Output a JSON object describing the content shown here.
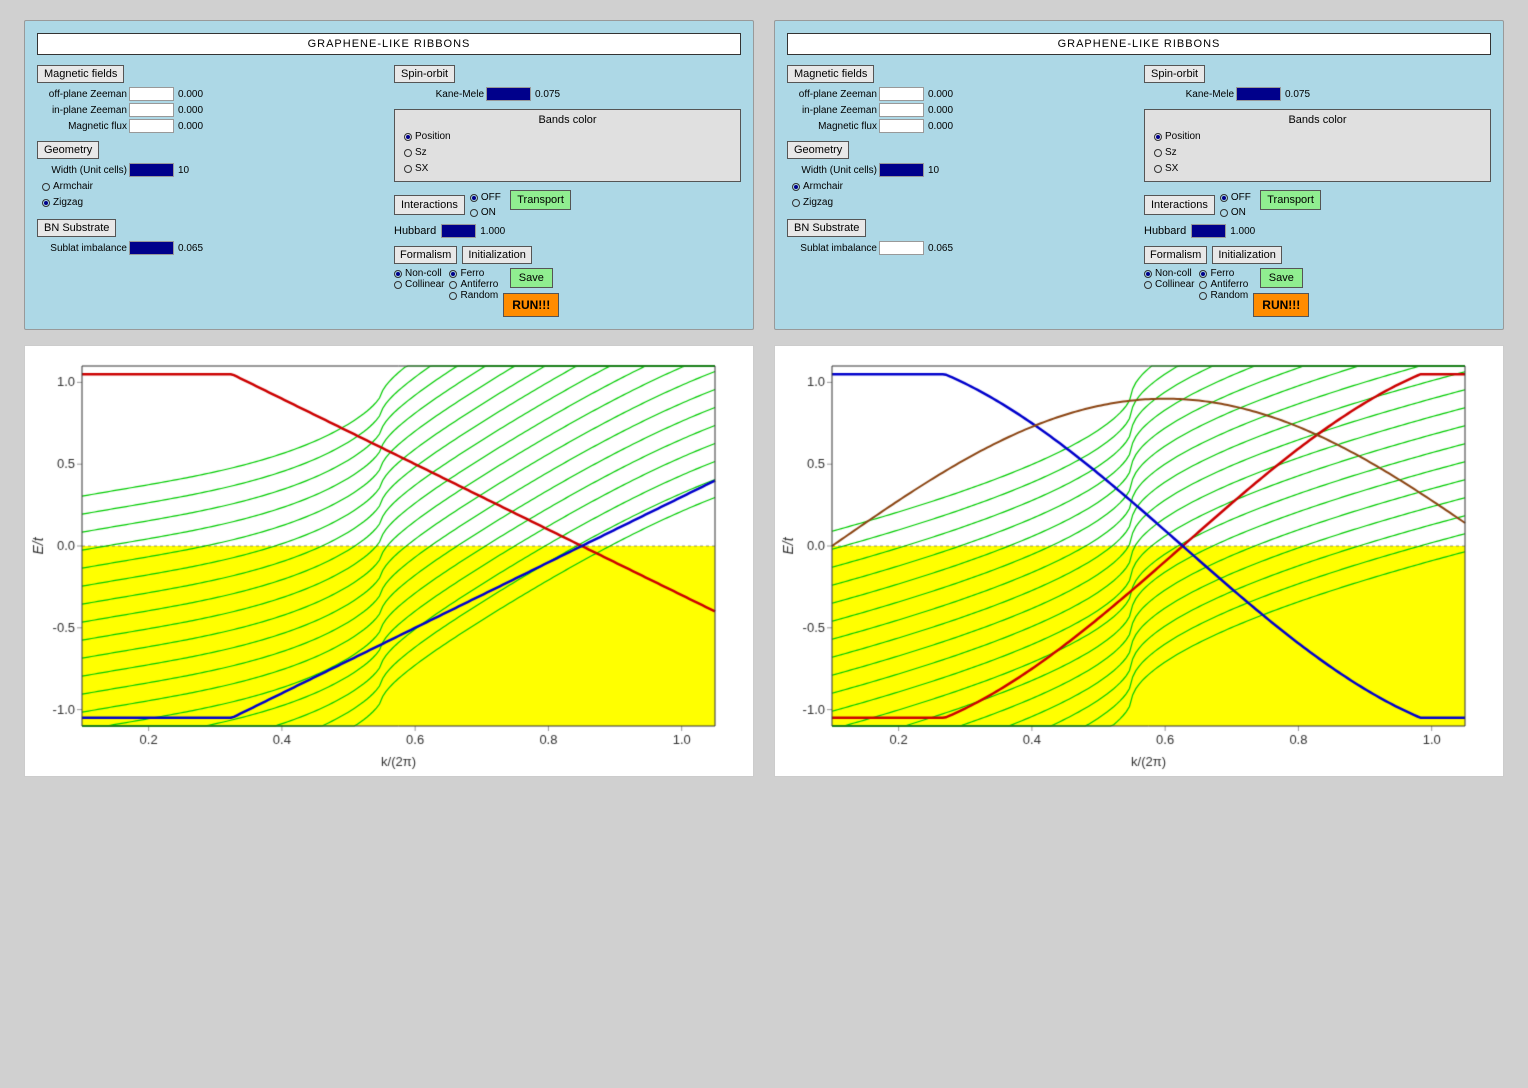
{
  "panels": [
    {
      "id": "panel-left",
      "title": "GRAPHENE-LIKE RIBBONS",
      "magnetic_fields_label": "Magnetic fields",
      "spin_orbit_label": "Spin-orbit",
      "off_plane_label": "off-plane Zeeman",
      "off_plane_value": "0.000",
      "in_plane_label": "in-plane Zeeman",
      "in_plane_value": "0.000",
      "mag_flux_label": "Magnetic flux",
      "mag_flux_value": "0.000",
      "kane_mele_label": "Kane-Mele",
      "kane_mele_value": "0.075",
      "bands_color_label": "Bands color",
      "bands_position": "Position",
      "bands_sz": "Sz",
      "bands_sx": "SX",
      "geometry_label": "Geometry",
      "width_label": "Width (Unit cells)",
      "width_value": "10",
      "armchair_label": "Armchair",
      "zigzag_label": "Zigzag",
      "bn_label": "BN Substrate",
      "sublat_label": "Sublat imbalance",
      "sublat_value": "0.065",
      "interactions_label": "Interactions",
      "off_label": "OFF",
      "on_label": "ON",
      "hubbard_label": "Hubbard",
      "hubbard_value": "1.000",
      "transport_label": "Transport",
      "save_label": "Save",
      "run_label": "RUN!!!",
      "formalism_label": "Formalism",
      "initialization_label": "Initialization",
      "non_coll_label": "Non-coll",
      "collinear_label": "Collinear",
      "ferro_label": "Ferro",
      "antiferro_label": "Antiferro",
      "random_label": "Random",
      "zigzag_selected": true,
      "position_selected": true,
      "off_selected": true,
      "non_coll_selected": true,
      "ferro_selected": true
    },
    {
      "id": "panel-right",
      "title": "GRAPHENE-LIKE RIBBONS",
      "magnetic_fields_label": "Magnetic fields",
      "spin_orbit_label": "Spin-orbit",
      "off_plane_label": "off-plane Zeeman",
      "off_plane_value": "0.000",
      "in_plane_label": "in-plane Zeeman",
      "in_plane_value": "0.000",
      "mag_flux_label": "Magnetic flux",
      "mag_flux_value": "0.000",
      "kane_mele_label": "Kane-Mele",
      "kane_mele_value": "0.075",
      "bands_color_label": "Bands color",
      "bands_position": "Position",
      "bands_sz": "Sz",
      "bands_sx": "SX",
      "geometry_label": "Geometry",
      "width_label": "Width (Unit cells)",
      "width_value": "10",
      "armchair_label": "Armchair",
      "zigzag_label": "Zigzag",
      "bn_label": "BN Substrate",
      "sublat_label": "Sublat imbalance",
      "sublat_value": "0.065",
      "interactions_label": "Interactions",
      "off_label": "OFF",
      "on_label": "ON",
      "hubbard_label": "Hubbard",
      "hubbard_value": "1.000",
      "transport_label": "Transport",
      "save_label": "Save",
      "run_label": "RUN!!!",
      "formalism_label": "Formalism",
      "initialization_label": "Initialization",
      "non_coll_label": "Non-coll",
      "collinear_label": "Collinear",
      "ferro_label": "Ferro",
      "antiferro_label": "Antiferro",
      "random_label": "Random",
      "zigzag_selected": true,
      "position_selected": true,
      "off_selected": true,
      "non_coll_selected": true,
      "ferro_selected": true
    }
  ],
  "charts": [
    {
      "id": "chart-left",
      "y_axis_label": "E/t",
      "x_axis_label": "k/(2π)",
      "y_min": -1.0,
      "y_max": 1.0,
      "x_min": 0.1,
      "x_max": 1.0,
      "x_ticks": [
        0.2,
        0.4,
        0.6,
        0.8,
        1.0
      ],
      "y_ticks": [
        -1.0,
        -0.5,
        0.0,
        0.5,
        1.0
      ],
      "type": "zigzag"
    },
    {
      "id": "chart-right",
      "y_axis_label": "E/t",
      "x_axis_label": "k/(2π)",
      "y_min": -1.0,
      "y_max": 1.0,
      "x_min": 0.1,
      "x_max": 1.0,
      "x_ticks": [
        0.2,
        0.4,
        0.6,
        0.8,
        1.0
      ],
      "y_ticks": [
        -1.0,
        -0.5,
        0.0,
        0.5,
        1.0
      ],
      "type": "hubbard"
    }
  ]
}
